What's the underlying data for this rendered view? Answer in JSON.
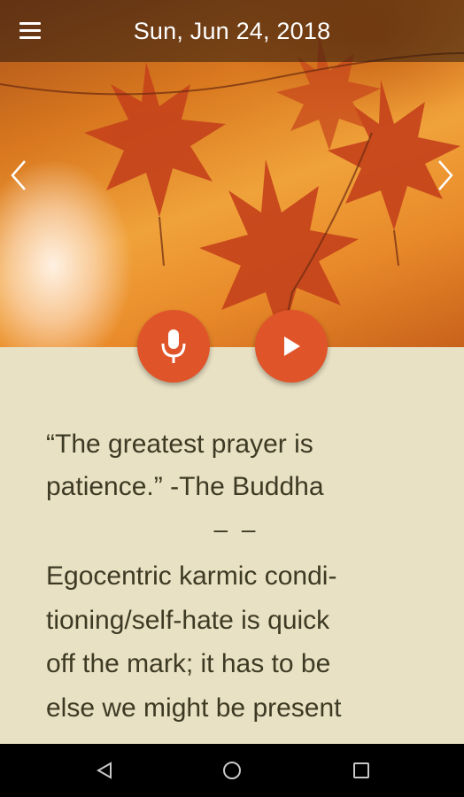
{
  "header": {
    "date": "Sun, Jun 24, 2018",
    "menu_icon": "hamburger-menu-icon"
  },
  "hero": {
    "prev_icon": "chevron-left-icon",
    "next_icon": "chevron-right-icon"
  },
  "actions": {
    "mic_icon": "microphone-icon",
    "play_icon": "play-icon",
    "fab_color": "#e0542a"
  },
  "content": {
    "quote": "“The greatest prayer is patience.” -The Buddha",
    "divider": "– –",
    "body_lines": [
      "Egocentric karmic condi-",
      "tioning/self-hate is quick",
      "off the mark; it has to be",
      "else we might be present"
    ]
  },
  "navbar": {
    "back_icon": "back-triangle-icon",
    "home_icon": "home-circle-icon",
    "recent_icon": "recent-apps-square-icon"
  }
}
